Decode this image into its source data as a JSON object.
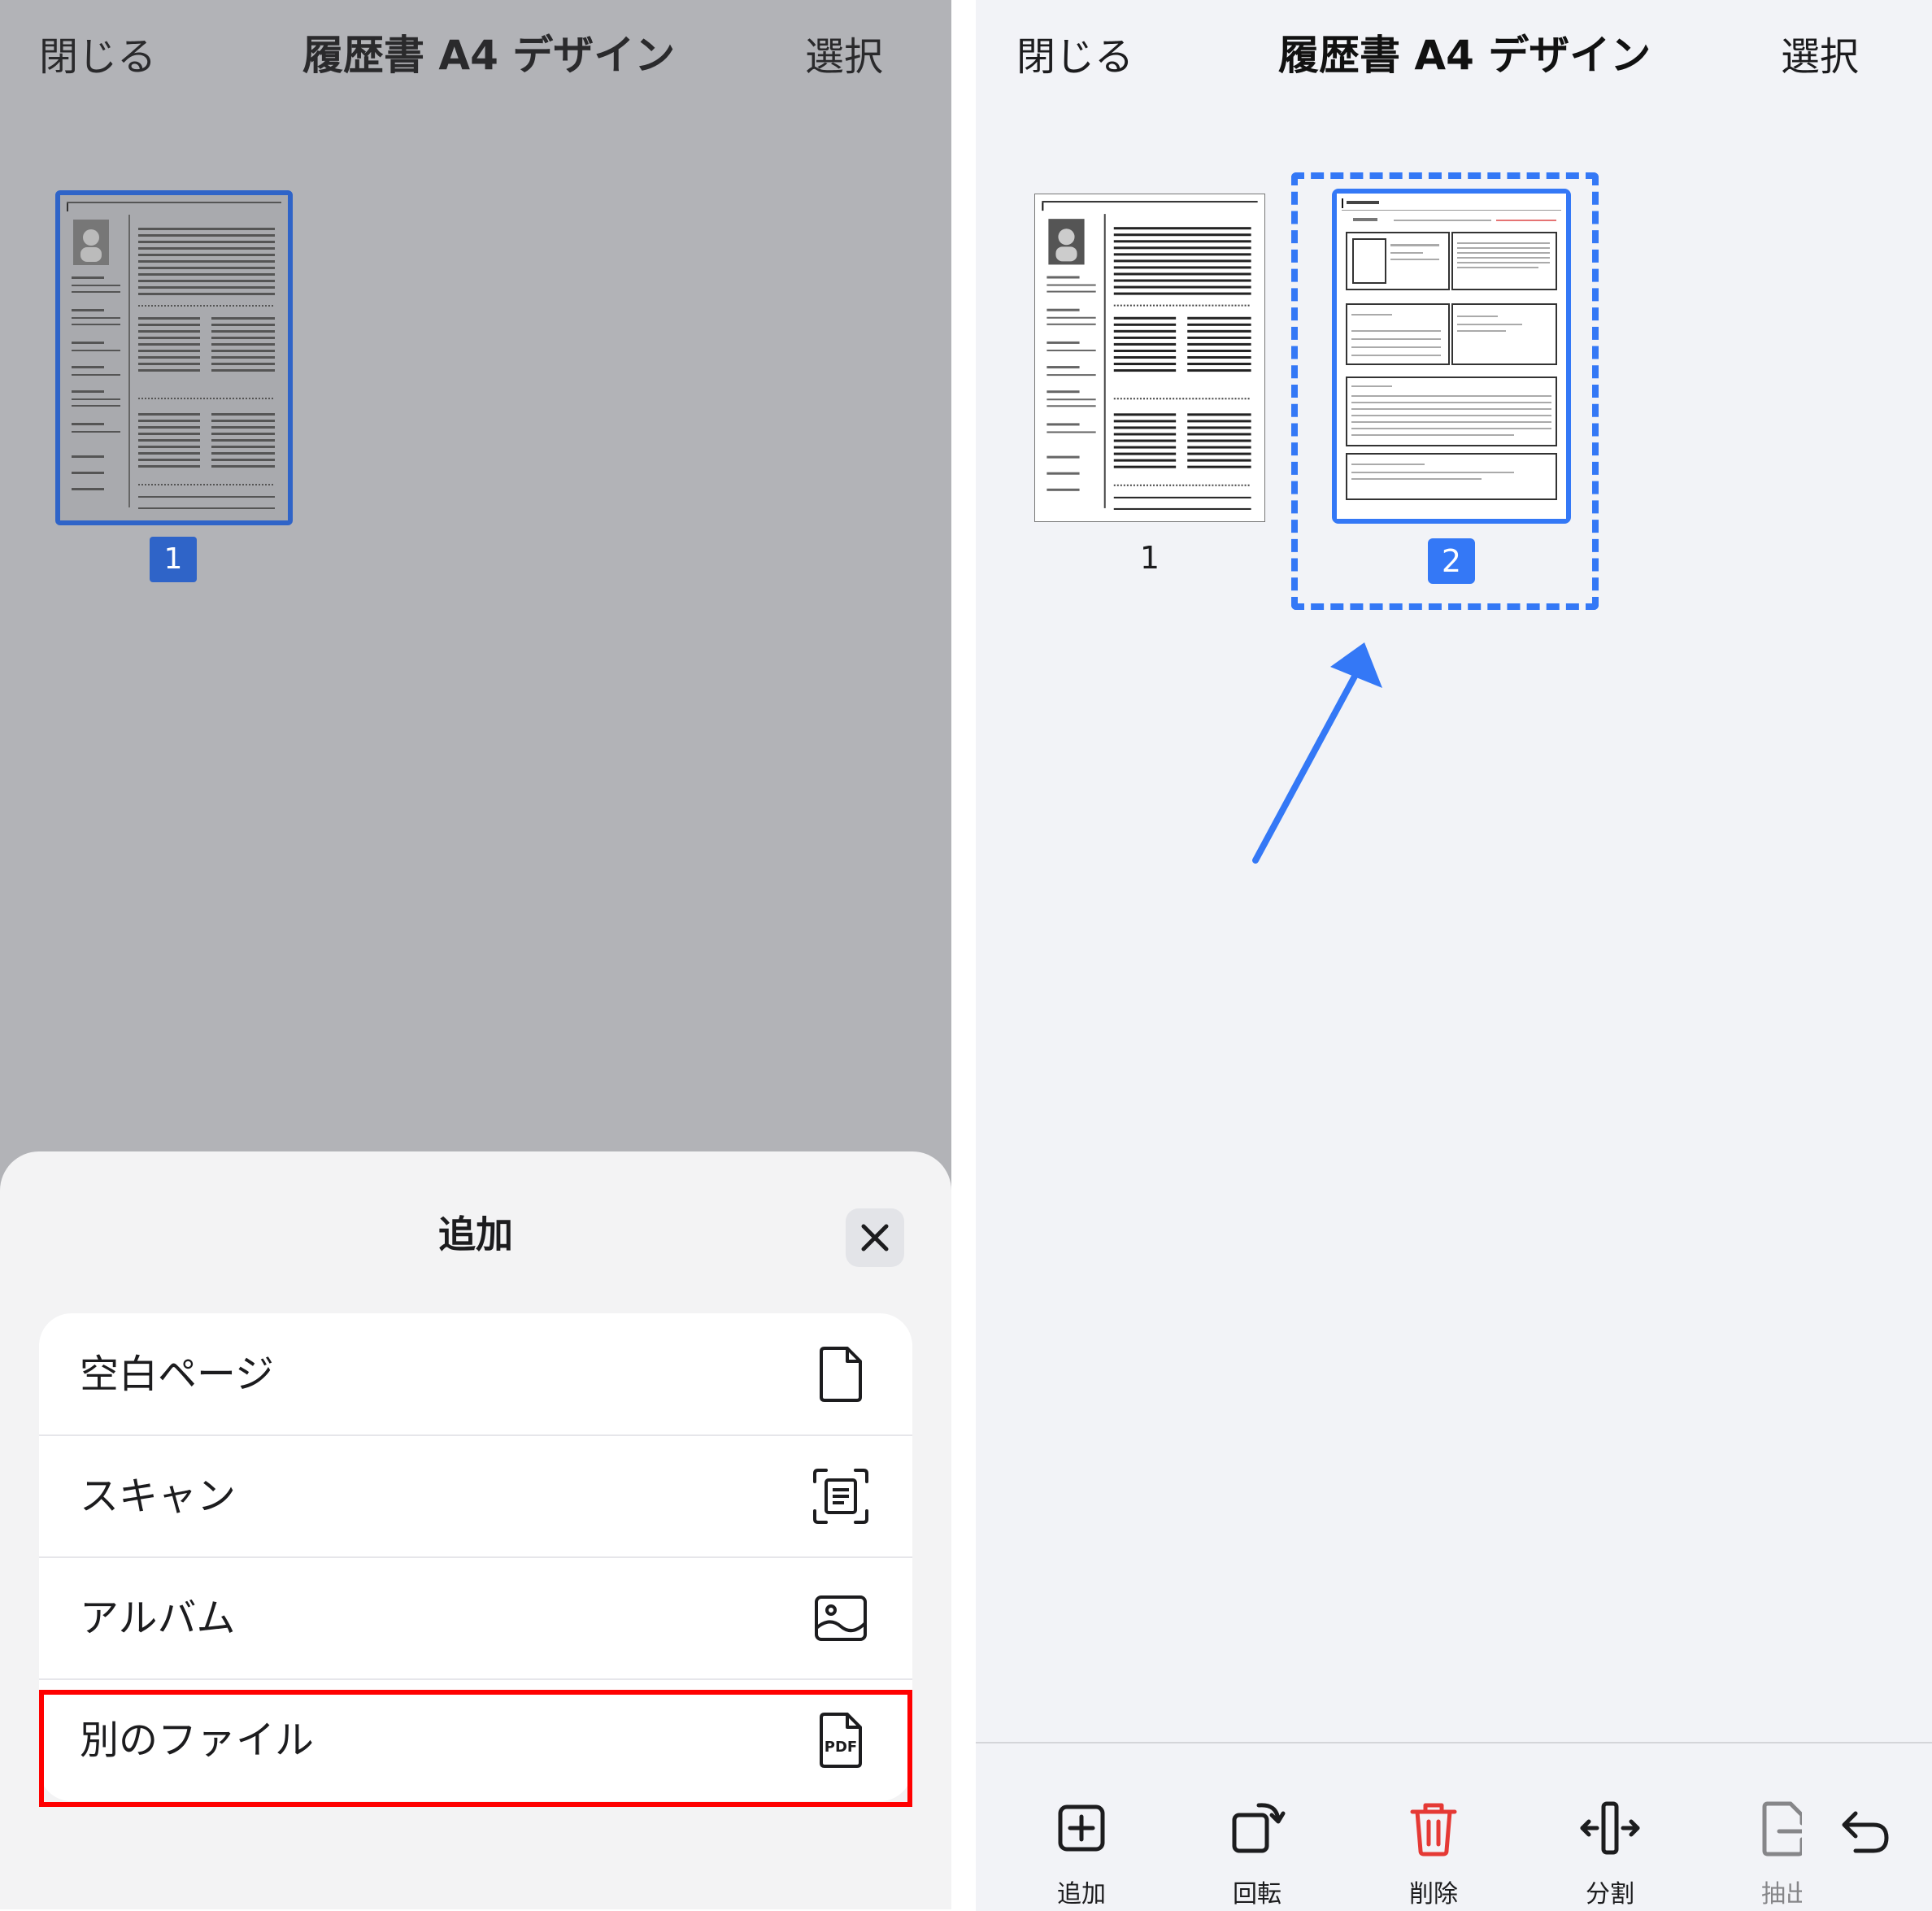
{
  "left_screen": {
    "nav": {
      "close": "閉じる",
      "title": "履歴書 A4 デザイン",
      "select": "選択"
    },
    "pages": [
      {
        "number": "1"
      }
    ],
    "sheet": {
      "title": "追加",
      "items": [
        {
          "label": "空白ページ",
          "icon": "blank-page-icon"
        },
        {
          "label": "スキャン",
          "icon": "scan-icon"
        },
        {
          "label": "アルバム",
          "icon": "album-icon"
        },
        {
          "label": "別のファイル",
          "icon": "pdf-file-icon",
          "icon_text": "PDF",
          "highlighted": true
        }
      ]
    }
  },
  "right_screen": {
    "nav": {
      "close": "閉じる",
      "title": "履歴書 A4 デザイン",
      "select": "選択"
    },
    "pages": [
      {
        "number": "1"
      },
      {
        "number": "2",
        "selected": true
      }
    ],
    "toolbar": [
      {
        "label": "追加",
        "icon": "add-page-icon"
      },
      {
        "label": "回転",
        "icon": "rotate-icon"
      },
      {
        "label": "削除",
        "icon": "trash-icon",
        "color": "#e53935"
      },
      {
        "label": "分割",
        "icon": "split-icon"
      },
      {
        "label": "抽出",
        "icon": "extract-icon"
      }
    ],
    "undo_icon": "undo-icon"
  },
  "colors": {
    "accent": "#3478f6",
    "highlight": "#ff0000",
    "delete": "#e53935",
    "dim_overlay": "#b2b3b7"
  }
}
